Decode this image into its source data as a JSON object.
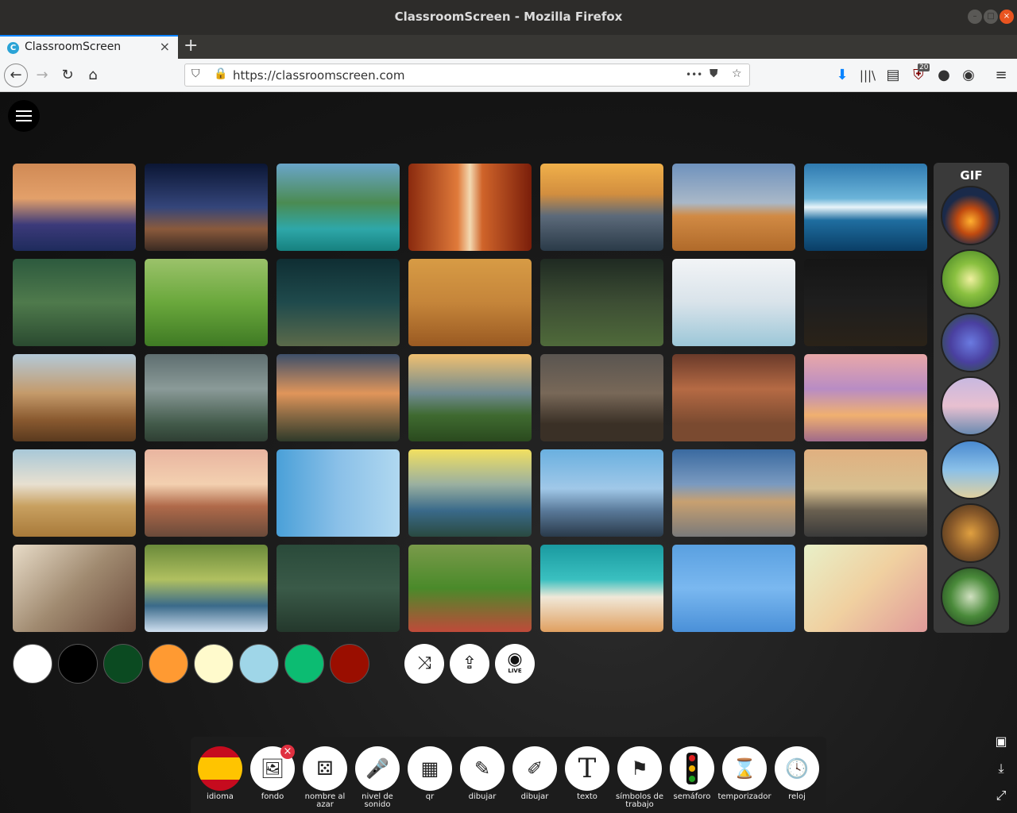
{
  "window": {
    "title": "ClassroomScreen - Mozilla Firefox"
  },
  "tab": {
    "favicon": "C",
    "label": "ClassroomScreen",
    "close": "×",
    "new": "+"
  },
  "nav": {
    "url": "https://classroomscreen.com",
    "more": "•••",
    "badge": "20"
  },
  "gif_panel": {
    "label": "GIF"
  },
  "tools": [
    {
      "label": "idioma",
      "icon": "spain-flag-icon",
      "glyph": ""
    },
    {
      "label": "fondo",
      "icon": "image-icon",
      "glyph": "🖼"
    },
    {
      "label": "nombre al azar",
      "icon": "random-name-icon",
      "glyph": "⚄"
    },
    {
      "label": "nivel de sonido",
      "icon": "microphone-icon",
      "glyph": "🎤"
    },
    {
      "label": "qr",
      "icon": "qr-icon",
      "glyph": "▦"
    },
    {
      "label": "dibujar",
      "icon": "pencil-icon",
      "glyph": "✎"
    },
    {
      "label": "dibujar",
      "icon": "pencil-line-icon",
      "glyph": "✐"
    },
    {
      "label": "texto",
      "icon": "text-icon",
      "glyph": "T"
    },
    {
      "label": "símbolos de trabajo",
      "icon": "work-symbols-icon",
      "glyph": "⚑"
    },
    {
      "label": "semáforo",
      "icon": "traffic-light-icon",
      "glyph": ""
    },
    {
      "label": "temporizador",
      "icon": "hourglass-icon",
      "glyph": "⌛"
    },
    {
      "label": "reloj",
      "icon": "clock-icon",
      "glyph": "🕓"
    }
  ],
  "colors": {
    "swatches": [
      "#ffffff",
      "#000000",
      "#0b4a21",
      "#ff9a32",
      "#fffacc",
      "#9fd6e8",
      "#0cbc72",
      "#9a0e00"
    ],
    "accent": "#0a84ff"
  },
  "actions": [
    {
      "name": "shuffle-button",
      "icon": "shuffle-icon",
      "glyph": "⤨"
    },
    {
      "name": "upload-button",
      "icon": "upload-icon",
      "glyph": "⇪"
    },
    {
      "name": "webcam-button",
      "icon": "webcam-icon",
      "glyph": "◉"
    }
  ],
  "webcam_badge": "LIVE"
}
